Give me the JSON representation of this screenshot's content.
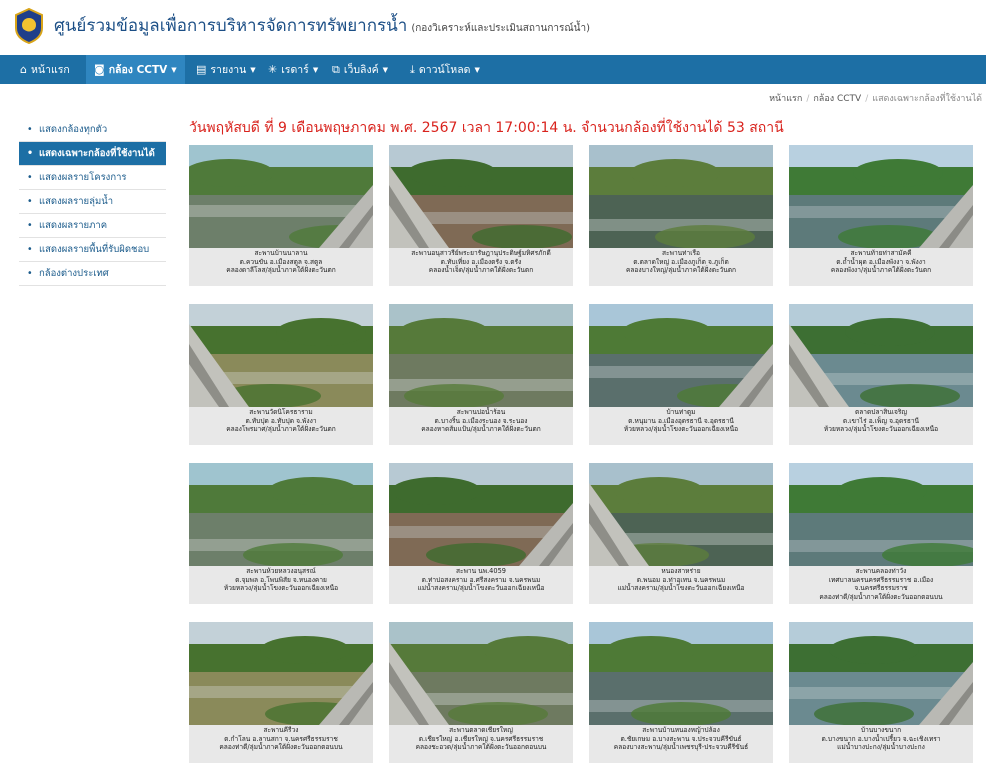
{
  "header": {
    "title": "ศูนย์รวมข้อมูลเพื่อการบริหารจัดการทรัพยากรน้ำ",
    "subtitle": "(กองวิเคราะห์และประเมินสถานการณ์น้ำ)"
  },
  "nav": {
    "home": "หน้าแรก",
    "cctv": "กล้อง CCTV",
    "report": "รายงาน",
    "radar": "เรดาร์",
    "weblink": "เว็บลิงค์",
    "download": "ดาวน์โหลด"
  },
  "breadcrumb": {
    "home": "หน้าแรก",
    "cctv": "กล้อง CCTV",
    "current": "แสดงเฉพาะกล้องที่ใช้งานได้"
  },
  "sidebar": {
    "items": [
      {
        "label": "แสดงกล้องทุกตัว"
      },
      {
        "label": "แสดงเฉพาะกล้องที่ใช้งานได้"
      },
      {
        "label": "แสดงผลรายโครงการ"
      },
      {
        "label": "แสดงผลรายลุ่มน้ำ"
      },
      {
        "label": "แสดงผลรายภาค"
      },
      {
        "label": "แสดงผลรายพื้นที่รับผิดชอบ"
      },
      {
        "label": "กล้องต่างประเทศ"
      }
    ]
  },
  "headline": {
    "text": "วันพฤหัสบดี ที่ 9 เดือนพฤษภาคม พ.ศ. 2567 เวลา 17:00:14 น. จำนวนกล้องที่ใช้งานได้",
    "count": "53",
    "unit": "สถานี"
  },
  "cameras": [
    {
      "l1": "สะพานบ้านนาลาน",
      "l2": "ต.ควนขัน อ.เมืองสตูล จ.สตูล",
      "l3": "คลองดาลีโลส/ลุ่มน้ำภาคใต้ฝั่งตะวันตก",
      "l4": ""
    },
    {
      "l1": "สะพานอนุสาวรีย์พระยารัษฎานุประดิษฐ์มหิศรภักดี",
      "l2": "ต.ทับเที่ยง อ.เมืองตรัง จ.ตรัง",
      "l3": "คลองน้ำเจ็ด/ลุ่มน้ำภาคใต้ฝั่งตะวันตก",
      "l4": ""
    },
    {
      "l1": "สะพานท่าเรือ",
      "l2": "ต.ตลาดใหญ่ อ.เมืองภูเก็ต จ.ภูเก็ต",
      "l3": "คลองบางใหญ่/ลุ่มน้ำภาคใต้ฝั่งตะวันตก",
      "l4": ""
    },
    {
      "l1": "สะพานท้ายท่าสามัคคี",
      "l2": "ต.ถ้ำน้ำผุด อ.เมืองพังงา จ.พังงา",
      "l3": "คลองพังงา/ลุ่มน้ำภาคใต้ฝั่งตะวันตก",
      "l4": ""
    },
    {
      "l1": "สะพานวัดนิโครธาราม",
      "l2": "ต.ทับปุด อ.ทับปุด จ.พังงา",
      "l3": "คลองโพรมาศ/ลุ่มน้ำภาคใต้ฝั่งตะวันตก",
      "l4": ""
    },
    {
      "l1": "สะพานบ่อน้ำร้อน",
      "l2": "ต.บางริ้น อ.เมืองระนอง จ.ระนอง",
      "l3": "คลองหาดส้มแป้น/ลุ่มน้ำภาคใต้ฝั่งตะวันตก",
      "l4": ""
    },
    {
      "l1": "บ้านท่าตูม",
      "l2": "ต.หนุมาน อ.เมืองอุดรธานี จ.อุดรธานี",
      "l3": "ห้วยหลวง/ลุ่มน้ำโขงตะวันออกเฉียงเหนือ",
      "l4": ""
    },
    {
      "l1": "ตลาดปลาสินเจริญ",
      "l2": "ต.เขาไร่ อ.เพ็ญ จ.อุดรธานี",
      "l3": "ห้วยหลวง/ลุ่มน้ำโขงตะวันออกเฉียงเหนือ",
      "l4": ""
    },
    {
      "l1": "สะพานห้วยหลวงอนุสรณ์",
      "l2": "ต.จุมพล อ.โพนพิสัย จ.หนองคาย",
      "l3": "ห้วยหลวง/ลุ่มน้ำโขงตะวันออกเฉียงเหนือ",
      "l4": ""
    },
    {
      "l1": "สะพาน นพ.4059",
      "l2": "ต.ท่าบ่อสงคราม อ.ศรีสงคราม จ.นครพนม",
      "l3": "แม่น้ำสงคราม/ลุ่มน้ำโขงตะวันออกเฉียงเหนือ",
      "l4": ""
    },
    {
      "l1": "หนองสาหร่าย",
      "l2": "ต.พนอม อ.ท่าอุเทน จ.นครพนม",
      "l3": "แม่น้ำสงคราม/ลุ่มน้ำโขงตะวันออกเฉียงเหนือ",
      "l4": ""
    },
    {
      "l1": "สะพานคลองท่าวัง",
      "l2": "เทศบาลนครนครศรีธรรมราช อ.เมือง",
      "l3": "จ.นครศรีธรรมราช",
      "l4": "คลองท่าดี/ลุ่มน้ำภาคใต้ฝั่งตะวันออกตอนบน"
    },
    {
      "l1": "สะพานคีรีวง",
      "l2": "ต.กำโลน อ.ลานสกา จ.นครศรีธรรมราช",
      "l3": "คลองท่าดี/ลุ่มน้ำภาคใต้ฝั่งตะวันออกตอนบน",
      "l4": ""
    },
    {
      "l1": "สะพานตลาดเชียรใหญ่",
      "l2": "ต.เชียรใหญ่ อ.เชียรใหญ่ จ.นครศรีธรรมราช",
      "l3": "คลองชะอวด/ลุ่มน้ำภาคใต้ฝั่งตะวันออกตอนบน",
      "l4": ""
    },
    {
      "l1": "สะพานบ้านหนองหญ้าปล้อง",
      "l2": "ต.ชัยเกษม อ.บางสะพาน จ.ประจวบคีรีขันธ์",
      "l3": "คลองบางสะพาน/ลุ่มน้ำเพชรบุรี-ประจวบคีรีขันธ์",
      "l4": ""
    },
    {
      "l1": "บ้านบางขนาก",
      "l2": "ต.บางขนาก อ.บางน้ำเปรี้ยว จ.ฉะเชิงเทรา",
      "l3": "แม่น้ำบางปะกง/ลุ่มน้ำบางปะกง",
      "l4": ""
    }
  ],
  "colors": {
    "navbar": "#1d6fa5",
    "headline": "#d9231d",
    "title": "#1c4f86"
  }
}
